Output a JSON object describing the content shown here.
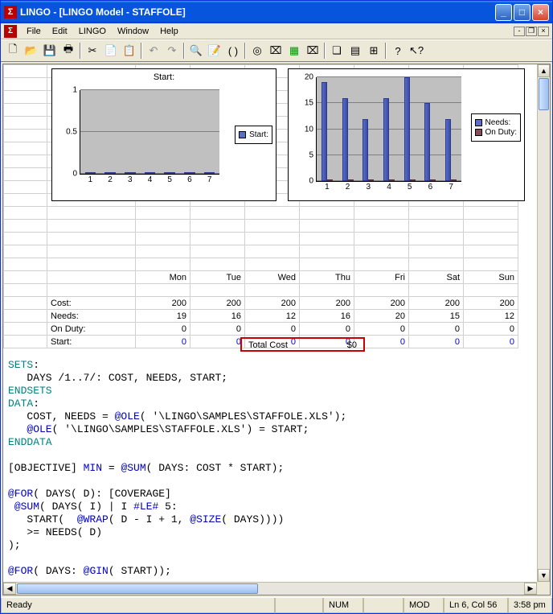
{
  "window": {
    "title": "LINGO - [LINGO Model - STAFFOLE]"
  },
  "menu": {
    "file": "File",
    "edit": "Edit",
    "lingo": "LINGO",
    "window": "Window",
    "help": "Help"
  },
  "status": {
    "ready": "Ready",
    "num": "NUM",
    "mod": "MOD",
    "pos": "Ln 6, Col 56",
    "time": "3:58 pm"
  },
  "table": {
    "days": [
      "Mon",
      "Tue",
      "Wed",
      "Thu",
      "Fri",
      "Sat",
      "Sun"
    ],
    "rows": {
      "cost": {
        "label": "Cost:",
        "values": [
          200,
          200,
          200,
          200,
          200,
          200,
          200
        ]
      },
      "needs": {
        "label": "Needs:",
        "values": [
          19,
          16,
          12,
          16,
          20,
          15,
          12
        ]
      },
      "on_duty": {
        "label": "On Duty:",
        "values": [
          0,
          0,
          0,
          0,
          0,
          0,
          0
        ]
      },
      "start": {
        "label": "Start:",
        "values": [
          0,
          0,
          0,
          0,
          0,
          0,
          0
        ]
      }
    }
  },
  "total": {
    "label": "Total Cost",
    "value": "$0"
  },
  "chart_data": [
    {
      "type": "bar",
      "title": "Start:",
      "categories": [
        "1",
        "2",
        "3",
        "4",
        "5",
        "6",
        "7"
      ],
      "series": [
        {
          "name": "Start:",
          "values": [
            0,
            0,
            0,
            0,
            0,
            0,
            0
          ],
          "color": "#5a6ec8"
        }
      ],
      "ylim": [
        0,
        1
      ],
      "yticks": [
        0,
        0.5,
        1
      ]
    },
    {
      "type": "bar",
      "title": "",
      "categories": [
        "1",
        "2",
        "3",
        "4",
        "5",
        "6",
        "7"
      ],
      "series": [
        {
          "name": "Needs:",
          "values": [
            19,
            16,
            12,
            16,
            20,
            15,
            12
          ],
          "color": "#5a6ec8"
        },
        {
          "name": "On Duty:",
          "values": [
            0,
            0,
            0,
            0,
            0,
            0,
            0
          ],
          "color": "#8a4a5a"
        }
      ],
      "ylim": [
        0,
        20
      ],
      "yticks": [
        0,
        5,
        10,
        15,
        20
      ]
    }
  ],
  "code": {
    "t1": "SETS",
    "t2": ":",
    "t3": "   DAYS /1..7/: COST, NEEDS, START;",
    "t4": "ENDSETS",
    "t5": "DATA",
    "t6": "   COST, NEEDS = ",
    "t7": "@OLE",
    "t7b": "( '\\LINGO\\SAMPLES\\STAFFOLE.XLS');",
    "t8a": "   ",
    "t8": "@OLE",
    "t8b": "( '\\LINGO\\SAMPLES\\STAFFOLE.XLS') = START;",
    "t9": "ENDDATA",
    "t10": "[OBJECTIVE] ",
    "t10a": "MIN",
    "t10b": " = ",
    "t10c": "@SUM",
    "t10d": "( DAYS: COST * START);",
    "t11": "@FOR",
    "t11b": "( DAYS( D): [COVERAGE]",
    "t12a": " ",
    "t12": "@SUM",
    "t12b": "( DAYS( I) | I ",
    "t12c": "#LE#",
    "t12d": " 5:",
    "t13": "   START(  ",
    "t13a": "@WRAP",
    "t13b": "( D - I + 1, ",
    "t13c": "@SIZE",
    "t13d": "( DAYS))))",
    "t14": "   >= NEEDS( D)",
    "t15": ");",
    "t16": "@FOR",
    "t16b": "( DAYS: ",
    "t16c": "@GIN",
    "t16d": "( START));"
  }
}
